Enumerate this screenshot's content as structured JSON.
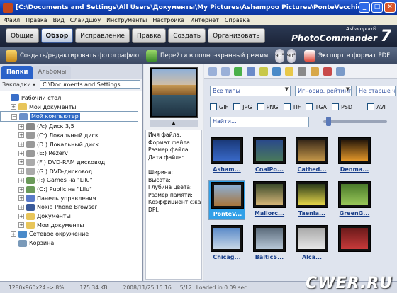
{
  "window": {
    "title": "[C:\\Documents and Settings\\All Users\\Документы\\My Pictures\\Ashampoo Pictures\\PonteVecchio.jpg] - A...",
    "min": "_",
    "max": "□",
    "close": "✕"
  },
  "menu": [
    "Файл",
    "Правка",
    "Вид",
    "Слайдшоу",
    "Инструменты",
    "Настройка",
    "Интернет",
    "Справка"
  ],
  "tabs": [
    "Общие",
    "Обзор",
    "Исправление",
    "Правка",
    "Создать",
    "Организовать"
  ],
  "logo": {
    "brand": "Ashampoo®",
    "product": "PhotoCommander",
    "version": "7"
  },
  "toolbar": {
    "create_edit": "Создать/редактировать фотографию",
    "fullscreen": "Перейти в полноэкранный режим",
    "rotate_left": "90°",
    "rotate_right": "90°",
    "export_pdf": "Экспорт в формат PDF"
  },
  "left_panel": {
    "tab_folders": "Папки",
    "tab_albums": "Альбомы",
    "bookmarks": "Закладки ▾",
    "path": "C:\\Documents and Settings",
    "tree": [
      {
        "label": "Рабочий стол",
        "exp": "",
        "indent": 0,
        "color": "#3a6fc9"
      },
      {
        "label": "Мои документы",
        "exp": "+",
        "indent": 1,
        "color": "#e8c55a"
      },
      {
        "label": "Мой компьютер",
        "exp": "−",
        "indent": 1,
        "color": "#6b8fc9",
        "selected": true
      },
      {
        "label": "(A:) Диск 3,5",
        "exp": "+",
        "indent": 2,
        "color": "#888"
      },
      {
        "label": "(C:) Локальный диск",
        "exp": "+",
        "indent": 2,
        "color": "#999"
      },
      {
        "label": "(D:) Локальный диск",
        "exp": "+",
        "indent": 2,
        "color": "#999"
      },
      {
        "label": "(E:) Rezerv",
        "exp": "+",
        "indent": 2,
        "color": "#999"
      },
      {
        "label": "(F:) DVD-RAM дисковод",
        "exp": "+",
        "indent": 2,
        "color": "#aaa"
      },
      {
        "label": "(G:) DVD-дисковод",
        "exp": "+",
        "indent": 2,
        "color": "#aaa"
      },
      {
        "label": "(I:) Games на \"Lilu\"",
        "exp": "+",
        "indent": 2,
        "color": "#6b9a5a"
      },
      {
        "label": "(O:) Public на \"Lilu\"",
        "exp": "+",
        "indent": 2,
        "color": "#6b9a5a"
      },
      {
        "label": "Панель управления",
        "exp": "+",
        "indent": 2,
        "color": "#5a7ac9"
      },
      {
        "label": "Nokia Phone Browser",
        "exp": "+",
        "indent": 2,
        "color": "#3a5a9a"
      },
      {
        "label": "Документы",
        "exp": "+",
        "indent": 2,
        "color": "#e8c55a"
      },
      {
        "label": "Мои документы",
        "exp": "+",
        "indent": 2,
        "color": "#e8c55a"
      },
      {
        "label": "Сетевое окружение",
        "exp": "+",
        "indent": 1,
        "color": "#4a8ac9"
      },
      {
        "label": "Корзина",
        "exp": "",
        "indent": 1,
        "color": "#7a9ab9"
      }
    ]
  },
  "preview": {
    "scroll_arrow": "▲",
    "info_labels": [
      "Имя файла:",
      "Формат файла:",
      "Размер файла:",
      "Дата файла:",
      "",
      "Ширина:",
      "Высота:",
      "Глубина цвета:",
      "Размер памяти:",
      "Коэффициент сжа...",
      "DPI:"
    ]
  },
  "right_panel": {
    "filter_type": "Все типы",
    "filter_ignore": "Игнорир. рейтинг",
    "filter_age": "Не старше чем",
    "formats": [
      "GIF",
      "JPG",
      "PNG",
      "TIF",
      "TGA",
      "PSD",
      "AVI"
    ],
    "search_placeholder": "Найти...",
    "thumbnails": [
      {
        "caption": "Asham...",
        "c1": "#1a3a7a",
        "c2": "#3a6aca"
      },
      {
        "caption": "CoalPo...",
        "c1": "#2a4a8a",
        "c2": "#4a7a5a"
      },
      {
        "caption": "Cathed...",
        "c1": "#3a2a1a",
        "c2": "#c89a4a"
      },
      {
        "caption": "Denma...",
        "c1": "#2a1a0a",
        "c2": "#e89a2a"
      },
      {
        "caption": "PonteV...",
        "c1": "#8ab0d8",
        "c2": "#a8743a",
        "selected": true
      },
      {
        "caption": "Mallorc...",
        "c1": "#3a4a2a",
        "c2": "#d8b87a"
      },
      {
        "caption": "Taenia...",
        "c1": "#2a3a1a",
        "c2": "#e8d84a"
      },
      {
        "caption": "GreenG...",
        "c1": "#4a7a2a",
        "c2": "#9ac85a"
      },
      {
        "caption": "Chicag...",
        "c1": "#5a8ac8",
        "c2": "#c8d8e8"
      },
      {
        "caption": "BalticS...",
        "c1": "#5a6a7a",
        "c2": "#b8c8d8"
      },
      {
        "caption": "Alca...",
        "c1": "#a8a8a8",
        "c2": "#e8e8e8"
      },
      {
        "caption": "",
        "c1": "#6a1a1a",
        "c2": "#c83a3a"
      }
    ]
  },
  "status": {
    "dimensions": "1280x960x24 -> 8%",
    "size": "175.34 KB",
    "date": "2008/11/25 15:16",
    "index": "5/12",
    "loaded": "Loaded in 0.09 sec"
  },
  "watermark": "CWER.RU"
}
